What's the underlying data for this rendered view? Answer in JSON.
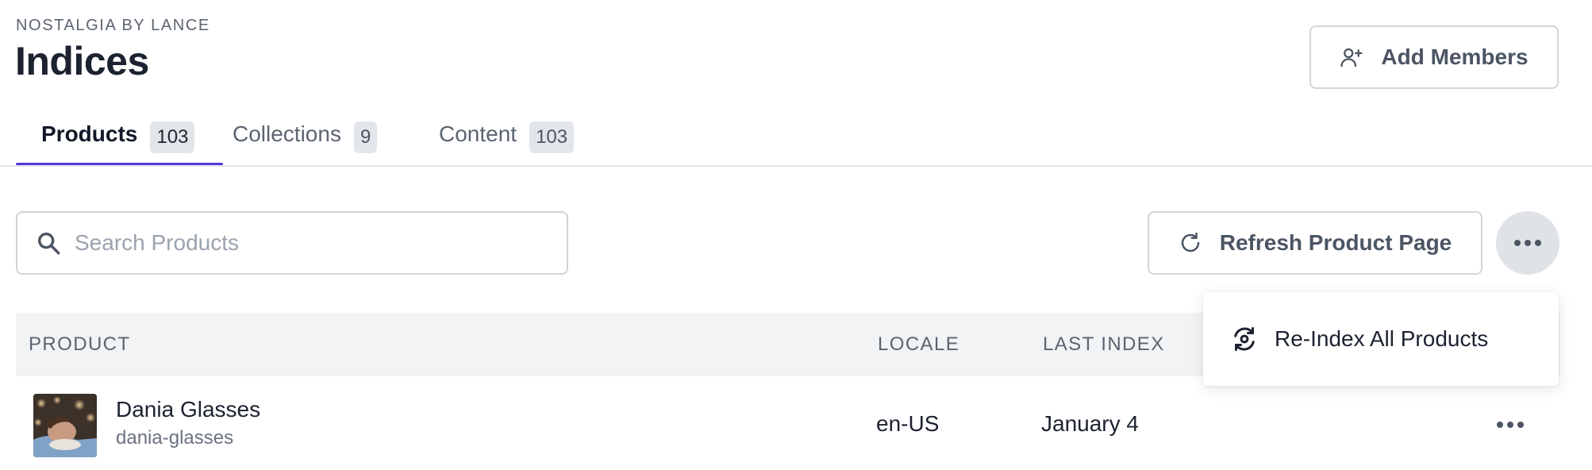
{
  "header": {
    "eyebrow": "NOSTALGIA BY LANCE",
    "title": "Indices",
    "add_members_label": "Add Members"
  },
  "tabs": [
    {
      "label": "Products",
      "count": "103",
      "active": true
    },
    {
      "label": "Collections",
      "count": "9",
      "active": false
    },
    {
      "label": "Content",
      "count": "103",
      "active": false
    }
  ],
  "search": {
    "placeholder": "Search Products",
    "value": ""
  },
  "toolbar": {
    "refresh_label": "Refresh Product Page"
  },
  "dropdown": {
    "items": [
      {
        "label": "Re-Index All Products",
        "icon": "reindex-icon"
      }
    ]
  },
  "table": {
    "columns": [
      "PRODUCT",
      "LOCALE",
      "LAST INDEX"
    ],
    "rows": [
      {
        "name": "Dania Glasses",
        "slug": "dania-glasses",
        "locale": "en-US",
        "last_index": "January 4"
      }
    ]
  },
  "colors": {
    "accent": "#4f3ad6",
    "header_bg": "#f1f3f5",
    "badge_bg": "#e2e6ea"
  }
}
